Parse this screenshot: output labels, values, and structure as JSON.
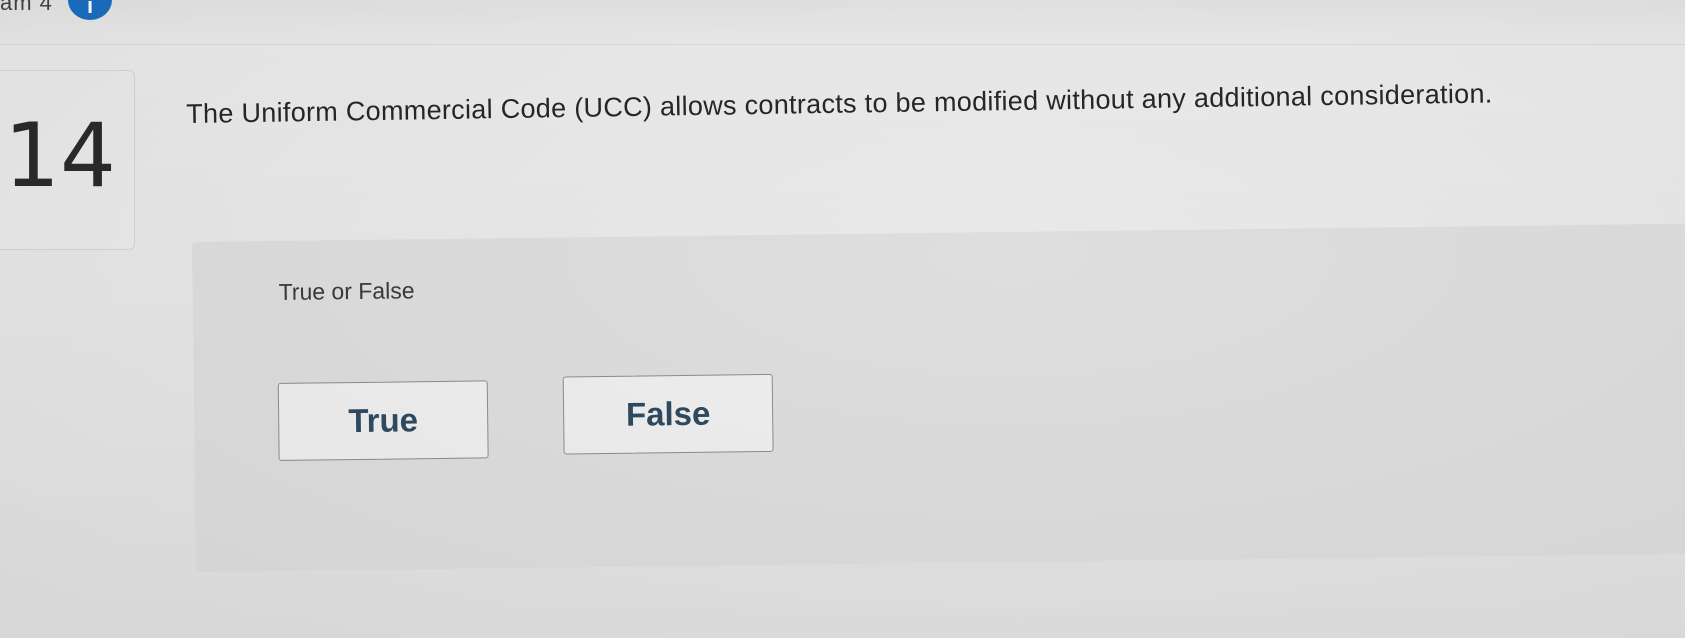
{
  "header": {
    "clipped_text": "am 4",
    "info_icon": "info-icon"
  },
  "question": {
    "number": "14",
    "text": "The Uniform Commercial Code (UCC) allows contracts to be modified without any additional consideration."
  },
  "answer": {
    "instruction": "True or False",
    "options": [
      {
        "label": "True"
      },
      {
        "label": "False"
      }
    ]
  },
  "colors": {
    "background": "#e9e9e9",
    "panel": "#dedede",
    "button_text": "#2f4a60",
    "info_icon": "#1a6fc1"
  }
}
